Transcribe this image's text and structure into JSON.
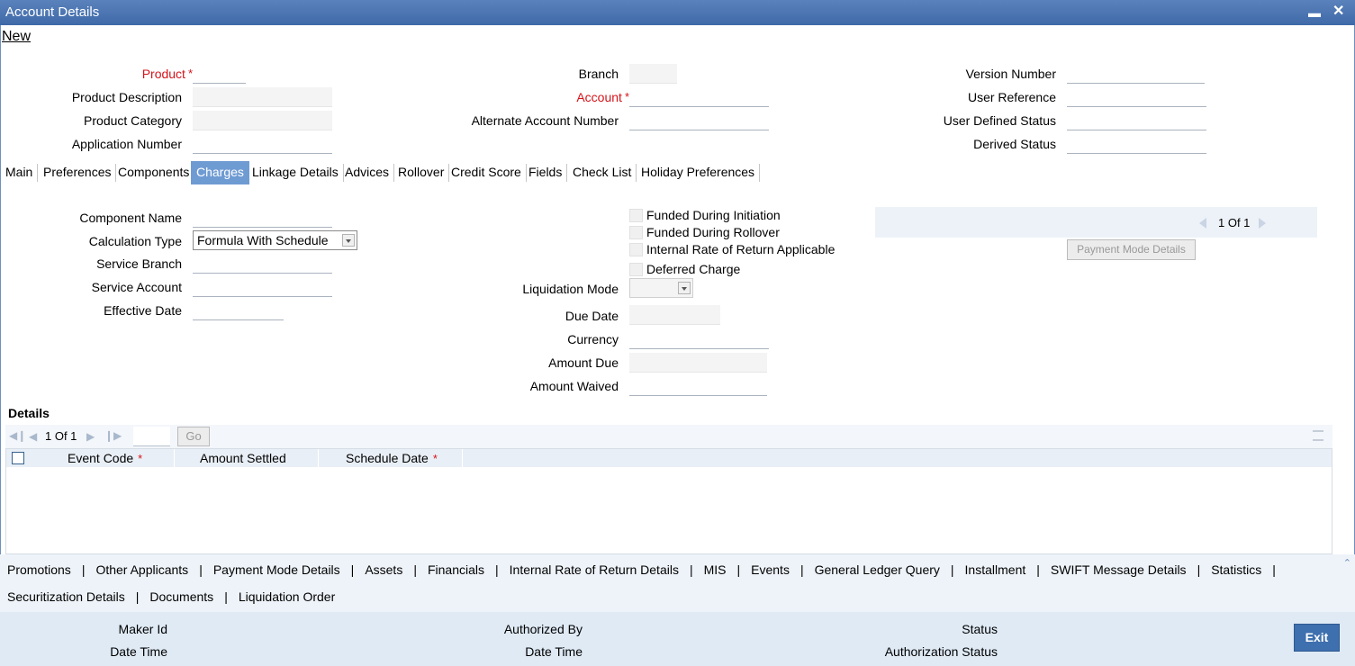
{
  "window": {
    "title": "Account Details"
  },
  "toolbar": {
    "new_label": "New"
  },
  "header": {
    "product": "Product",
    "product_description": "Product Description",
    "product_category": "Product Category",
    "application_number": "Application Number",
    "branch": "Branch",
    "account": "Account",
    "alternate_account_number": "Alternate Account Number",
    "version_number": "Version Number",
    "user_reference": "User Reference",
    "user_defined_status": "User Defined Status",
    "derived_status": "Derived Status"
  },
  "required_mark": "*",
  "tabs": [
    "Main",
    "Preferences",
    "Components",
    "Charges",
    "Linkage Details",
    "Advices",
    "Rollover",
    "Credit Score",
    "Fields",
    "Check List",
    "Holiday Preferences"
  ],
  "active_tab": "Charges",
  "charges": {
    "component_name": "Component Name",
    "calculation_type": "Calculation Type",
    "calculation_type_value": "Formula With Schedule",
    "service_branch": "Service Branch",
    "service_account": "Service Account",
    "effective_date": "Effective Date",
    "funded_during_initiation": "Funded During Initiation",
    "funded_during_rollover": "Funded During Rollover",
    "irr_applicable": "Internal Rate of Return Applicable",
    "deferred_charge": "Deferred Charge",
    "liquidation_mode": "Liquidation Mode",
    "due_date": "Due Date",
    "currency": "Currency",
    "amount_due": "Amount Due",
    "amount_waived": "Amount Waived",
    "pager": "1 Of 1",
    "payment_mode_details_button": "Payment Mode Details"
  },
  "details": {
    "title": "Details",
    "pager": "1 Of 1",
    "go_label": "Go",
    "columns": [
      "Event Code",
      "Amount Settled",
      "Schedule Date"
    ]
  },
  "bottom_links": {
    "row1": [
      "Promotions",
      "Other Applicants",
      "Payment Mode Details",
      "Assets",
      "Financials",
      "Internal Rate of Return Details",
      "MIS",
      "Events",
      "General Ledger Query",
      "Installment",
      "SWIFT Message Details",
      "Statistics"
    ],
    "row2": [
      "Securitization Details",
      "Documents",
      "Liquidation Order"
    ],
    "separator": "|"
  },
  "footer": {
    "maker_id": "Maker Id",
    "date_time": "Date Time",
    "authorized_by": "Authorized By",
    "checker_date_time": "Date Time",
    "status": "Status",
    "authorization_status": "Authorization Status",
    "exit_label": "Exit"
  },
  "colors": {
    "titlebar": "#3f6aa8",
    "active_tab": "#6f9bd3",
    "required": "#d4141a",
    "footer": "#dfeaf5",
    "exit_button": "#3e6fae"
  }
}
